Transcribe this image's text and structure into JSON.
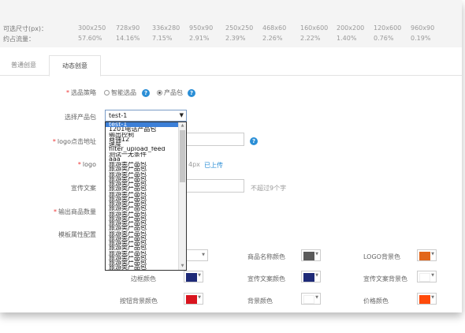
{
  "size_table": {
    "size_label": "可选尺寸(px)：",
    "traffic_label": "约占流量：",
    "sizes": [
      "300x250",
      "728x90",
      "336x280",
      "950x90",
      "250x250",
      "468x60",
      "160x600",
      "200x200",
      "120x600",
      "960x90"
    ],
    "traffic": [
      "57.60%",
      "14.16%",
      "7.15%",
      "2.91%",
      "2.39%",
      "2.26%",
      "2.22%",
      "1.40%",
      "0.76%",
      "0.19%"
    ]
  },
  "tabs": [
    {
      "label": "普通创意",
      "active": false
    },
    {
      "label": "动态创意",
      "active": true
    }
  ],
  "form": {
    "strategy_label": "选品策略",
    "strategy_options": [
      {
        "label": "智能选品",
        "checked": false
      },
      {
        "label": "产品包",
        "checked": true
      }
    ],
    "help_glyph": "?",
    "package_label": "选择产品包",
    "package_value": "test-1",
    "logo_url_label": "logo点击地址",
    "logo_label": "logo",
    "logo_hint": "4px",
    "logo_uploaded": "已上传",
    "slogan_label": "宣传文案",
    "slogan_hint": "不超过9个字",
    "product_count_label": "输出商品数量",
    "template_label": "模板属性配置"
  },
  "dropdown": {
    "options": [
      "test-1",
      "1201电话产品包",
      "输出控制",
      "商铺12",
      "速度",
      "filter_upload_feed",
      "测试一无条件",
      "aaa",
      "旅游类产品包",
      "旅游类产品包",
      "旅游类产品包",
      "旅游类产品包",
      "旅游类产品包",
      "旅游类产品包",
      "旅游类产品包",
      "旅游类产品包",
      "旅游类产品包",
      "旅游类产品包",
      "旅游类产品包",
      "旅游类产品包",
      "旅游类产品包",
      "旅游类产品包",
      "旅游类产品包",
      "旅游类产品包",
      "旅游类产品包",
      "旅游类产品包",
      "旅游类产品包",
      "旅游类产品包",
      "旅游类产品包",
      "旅游类产品包"
    ],
    "selected_index": 0
  },
  "colors": {
    "product_name_color_label": "商品名称颜色",
    "product_name_color": "#5a5a5a",
    "logo_bg_label": "LOGO背景色",
    "logo_bg_color": "#e2661b",
    "border_color_label": "边框颜色",
    "border_color": "#1e2a78",
    "slogan_color_label": "宣传文案颜色",
    "slogan_color": "#1e2a78",
    "slogan_bg_label": "宣传文案背景色",
    "slogan_bg_color": "#ffffff",
    "button_bg_label": "按钮背景颜色",
    "button_bg_color": "#d9141e",
    "bg_color_label": "背景颜色",
    "bg_color": "#ffffff",
    "price_color_label": "价格颜色",
    "price_color": "#ff4a0a",
    "accent": "#2a8ed6",
    "required_mark": "*"
  }
}
